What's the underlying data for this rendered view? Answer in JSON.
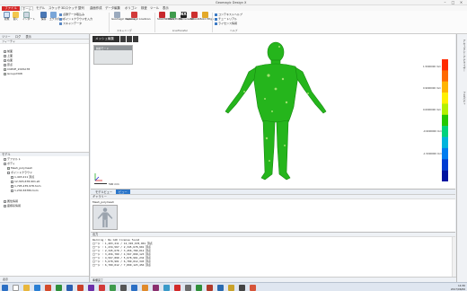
{
  "app": {
    "title": "Geomagic Design X"
  },
  "ribbon_tabs": [
    {
      "label": "ファイル"
    },
    {
      "label": "ホーム"
    },
    {
      "label": "モデル"
    },
    {
      "label": "スケッチ"
    },
    {
      "label": "3Dスケッチ"
    },
    {
      "label": "整列"
    },
    {
      "label": "曲面作成"
    },
    {
      "label": "データ編集"
    },
    {
      "label": "ポリゴン"
    },
    {
      "label": "検査"
    },
    {
      "label": "ツール"
    },
    {
      "label": "表示"
    }
  ],
  "ribbon": {
    "buttons": [
      {
        "label": "新規"
      },
      {
        "label": "開く"
      },
      {
        "label": "インポート"
      },
      {
        "label": "保存"
      },
      {
        "label": "エクスポート"
      }
    ],
    "import_items": [
      "点群データ取込み",
      "ポイントクラウドを入力",
      "スキャンデータ"
    ],
    "scanning_btn": "Geomagic\nCapture",
    "scanning_label": "スキャニング",
    "lr_label": "Geomagic LiveScan",
    "cad_buttons": [
      "SOLIDWORKS",
      "Creo(Pro/E)",
      "Siemens NX",
      "AutoCAD",
      "Solid Edge"
    ],
    "cad_label": "LiveTransfer",
    "help_items": [
      "コンテキストヘルプ",
      "チュートリアル",
      "ライセンス情報"
    ],
    "help_label": "ヘルプ"
  },
  "left_panel": {
    "tabs": [
      "ツリー",
      "ログ",
      "表示"
    ],
    "sub": "フィーチャ",
    "feature_items": [
      "前面",
      "上面",
      "右面",
      "原点",
      "CURVE_2015A78",
      "Group2308"
    ],
    "model_header": "モデル",
    "model_items": [
      "デフォルト",
      "ボディ",
      "Mesh_polymesh",
      "ポイントクラウド",
      "1,403,211 頂点",
      "12,345,678,901.stl",
      "1,795,235,978.hom",
      "1,234,56789.hom"
    ],
    "section_a": "属性情報",
    "section_b": "座標系情報",
    "bottom": "表示"
  },
  "viewport": {
    "title": "メッシュ編集",
    "overlay_header": "解析モード",
    "scale_label": "500 mm"
  },
  "colorbar": {
    "labels": [
      "1.5000000 mm",
      "1.2000000 mm",
      "0.9000000 mm",
      "0.6000000 mm",
      "0.3000000 mm",
      "0.0000000 mm",
      "-0.3000000 mm",
      "-0.6000000 mm",
      "-0.9000000 mm",
      "-1.2000000 mm",
      "-1.5000000 mm"
    ],
    "colors": [
      "#ff2a00",
      "#ff6a00",
      "#ffb400",
      "#fff000",
      "#b4f000",
      "#24c800",
      "#00d27d",
      "#00b4dc",
      "#007cf0",
      "#003cd2",
      "#0014a0"
    ]
  },
  "right_strip": {
    "tabs": [
      "アキュラシーアナライザー",
      "プロパティ"
    ]
  },
  "view_tabs": [
    "モデルビュー",
    "ビュー"
  ],
  "thumb_panel": {
    "header": "ギャラリー",
    "label": "Mesh_polymesh"
  },
  "log": {
    "header": "出力",
    "lines": [
      "Warning : No CAD license found",
      "ロード : 1,403,211 / 12,345,678,901 頂点",
      "ロード : 1,234,567 / 2,345,678,901 頂点",
      "ロード : 2,345,678 / 3,456,789,012 頂点",
      "ロード : 3,456,789 / 4,567,890,123 頂点",
      "ロード : 4,567,890 / 5,678,901,234 頂点",
      "ロード : 5,678,901 / 6,789,012,345 頂点",
      "ロード : 6,789,012 / 7,890,123,456 頂点"
    ]
  },
  "status": {
    "text": "準備完了"
  },
  "taskbar": {
    "time": "14:30",
    "date": "2017/06/06"
  }
}
